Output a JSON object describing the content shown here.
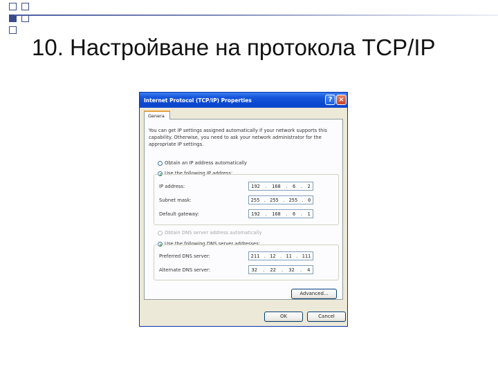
{
  "slide": {
    "title": "10. Настройване на протокола TCP/IP"
  },
  "dialog": {
    "title": "Internet Protocol (TCP/IP) Properties",
    "help_label": "?",
    "close_label": "×",
    "tab_label": "Genera",
    "intro": "You can get IP settings assigned automatically if your network supports this capability. Otherwise, you need to ask your network administrator for the appropriate IP settings.",
    "ip_auto_label": "Obtain an IP address automatically",
    "ip_manual_label": "Use the following IP address:",
    "ip_fields": [
      {
        "label": "IP address:",
        "octets": [
          "192",
          "168",
          "6",
          "2"
        ]
      },
      {
        "label": "Subnet mask:",
        "octets": [
          "255",
          "255",
          "255",
          "0"
        ]
      },
      {
        "label": "Default gateway:",
        "octets": [
          "192",
          "168",
          "6",
          "1"
        ]
      }
    ],
    "dns_auto_label": "Obtain DNS server address automatically",
    "dns_manual_label": "Use the following DNS server addresses:",
    "dns_fields": [
      {
        "label": "Preferred DNS server:",
        "octets": [
          "211",
          "12",
          "11",
          "111"
        ]
      },
      {
        "label": "Alternate DNS server:",
        "octets": [
          "32",
          "22",
          "32",
          "4"
        ]
      }
    ],
    "advanced_label": "Advanced...",
    "ok_label": "OK",
    "cancel_label": "Cancel"
  },
  "colors": {
    "titlebar": "#0a47cf",
    "dialog_bg": "#ece9d8",
    "deco_square": "#3a4a8c"
  }
}
